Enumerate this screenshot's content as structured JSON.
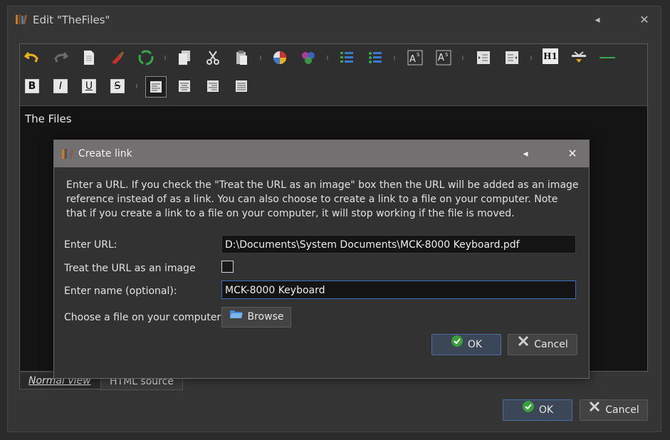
{
  "window": {
    "title": "Edit \"TheFiles\"",
    "back_glyph": "◂",
    "close_glyph": "✕"
  },
  "toolbar_icons": [
    "undo-icon",
    "redo-icon",
    "new-doc-icon",
    "clear-format-icon",
    "recycle-icon",
    "copy-icon",
    "cut-icon",
    "paste-icon",
    "background-color-icon",
    "foreground-color-icon",
    "numbered-list-icon",
    "bullet-list-icon",
    "superscript-icon",
    "subscript-icon",
    "decrease-indent-icon",
    "increase-indent-icon",
    "heading-icon",
    "insert-link-icon",
    "horizontal-rule-icon",
    "bold-icon",
    "italic-icon",
    "underline-icon",
    "strikethrough-icon",
    "align-left-icon",
    "align-center-icon",
    "align-right-icon",
    "justify-icon"
  ],
  "toolbar": {
    "bold": "B",
    "italic": "I",
    "underline": "U",
    "strike": "S",
    "heading": "H1"
  },
  "document": {
    "text": "The Files"
  },
  "tabs": {
    "normal": "Normal view",
    "html": "HTML source"
  },
  "buttons": {
    "ok": "OK",
    "cancel": "Cancel"
  },
  "dialog": {
    "title": "Create link",
    "back_glyph": "◂",
    "close_glyph": "✕",
    "description": "Enter a URL. If you check the \"Treat the URL as an image\" box then the URL will be added as an image reference instead of as a link. You can also choose to create a link to a file on your computer. Note that if you create a link to a file on your computer, it will stop working if the file is moved.",
    "url_label": "Enter URL:",
    "url_value": "D:\\Documents\\System Documents\\MCK-8000 Keyboard.pdf",
    "image_label": "Treat the URL as an image",
    "image_checked": false,
    "name_label": "Enter name (optional):",
    "name_value": "MCK-8000 Keyboard",
    "file_label": "Choose a file on your computer:",
    "browse_label": "Browse",
    "ok_label": "OK",
    "cancel_label": "Cancel"
  },
  "colors": {
    "accent": "#3c6bc0",
    "dialog_title": "#727070",
    "ok_green": "#3aa03a",
    "cancel_gray": "#d0d0d0"
  }
}
